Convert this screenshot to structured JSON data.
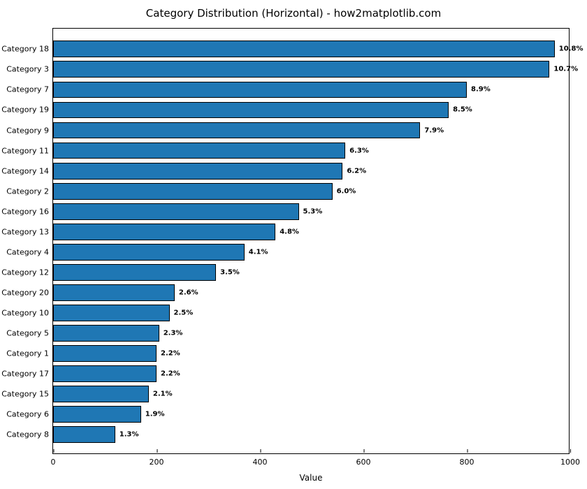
{
  "chart_data": {
    "type": "bar",
    "orientation": "horizontal",
    "title": "Category Distribution (Horizontal) - how2matplotlib.com",
    "xlabel": "Value",
    "ylabel": "",
    "xlim": [
      0,
      1000
    ],
    "xticks": [
      0,
      200,
      400,
      600,
      800,
      1000
    ],
    "bar_color": "#1f77b4",
    "categories": [
      "Category 18",
      "Category 3",
      "Category 7",
      "Category 19",
      "Category 9",
      "Category 11",
      "Category 14",
      "Category 2",
      "Category 16",
      "Category 13",
      "Category 4",
      "Category 12",
      "Category 20",
      "Category 10",
      "Category 5",
      "Category 1",
      "Category 17",
      "Category 15",
      "Category 6",
      "Category 8"
    ],
    "values": [
      970,
      960,
      800,
      765,
      710,
      565,
      560,
      540,
      475,
      430,
      370,
      315,
      235,
      225,
      205,
      200,
      200,
      185,
      170,
      120
    ],
    "percent_labels": [
      "10.8%",
      "10.7%",
      "8.9%",
      "8.5%",
      "7.9%",
      "6.3%",
      "6.2%",
      "6.0%",
      "5.3%",
      "4.8%",
      "4.1%",
      "3.5%",
      "2.6%",
      "2.5%",
      "2.3%",
      "2.2%",
      "2.2%",
      "2.1%",
      "1.9%",
      "1.3%"
    ]
  }
}
